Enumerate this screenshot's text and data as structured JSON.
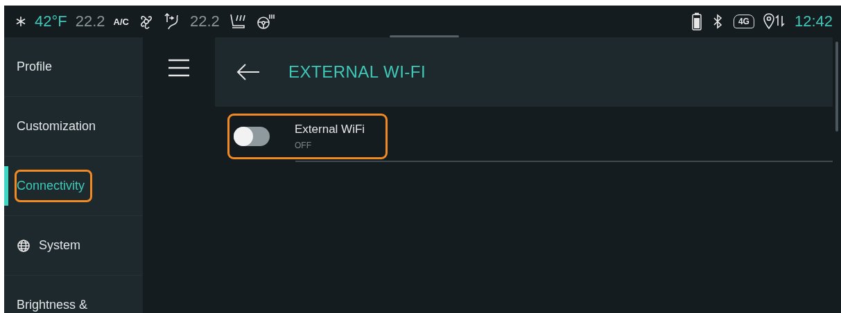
{
  "status_bar": {
    "outside_temp": "42°F",
    "driver_temp": "22.2",
    "ac_label": "A/C",
    "passenger_temp": "22.2",
    "network_label": "4G",
    "clock": "12:42"
  },
  "sidebar": {
    "items": [
      {
        "label": "Profile",
        "selected": false,
        "highlighted": false,
        "kind": "text"
      },
      {
        "label": "Customization",
        "selected": false,
        "highlighted": false,
        "kind": "text"
      },
      {
        "label": "Connectivity",
        "selected": true,
        "highlighted": true,
        "kind": "text"
      },
      {
        "label": "System",
        "selected": false,
        "highlighted": false,
        "kind": "globe"
      },
      {
        "label": "Brightness &",
        "selected": false,
        "highlighted": false,
        "kind": "text"
      }
    ]
  },
  "header": {
    "title": "EXTERNAL WI-FI"
  },
  "settings": [
    {
      "label": "External WiFi",
      "state_text": "OFF",
      "on": false,
      "highlighted": true
    }
  ]
}
